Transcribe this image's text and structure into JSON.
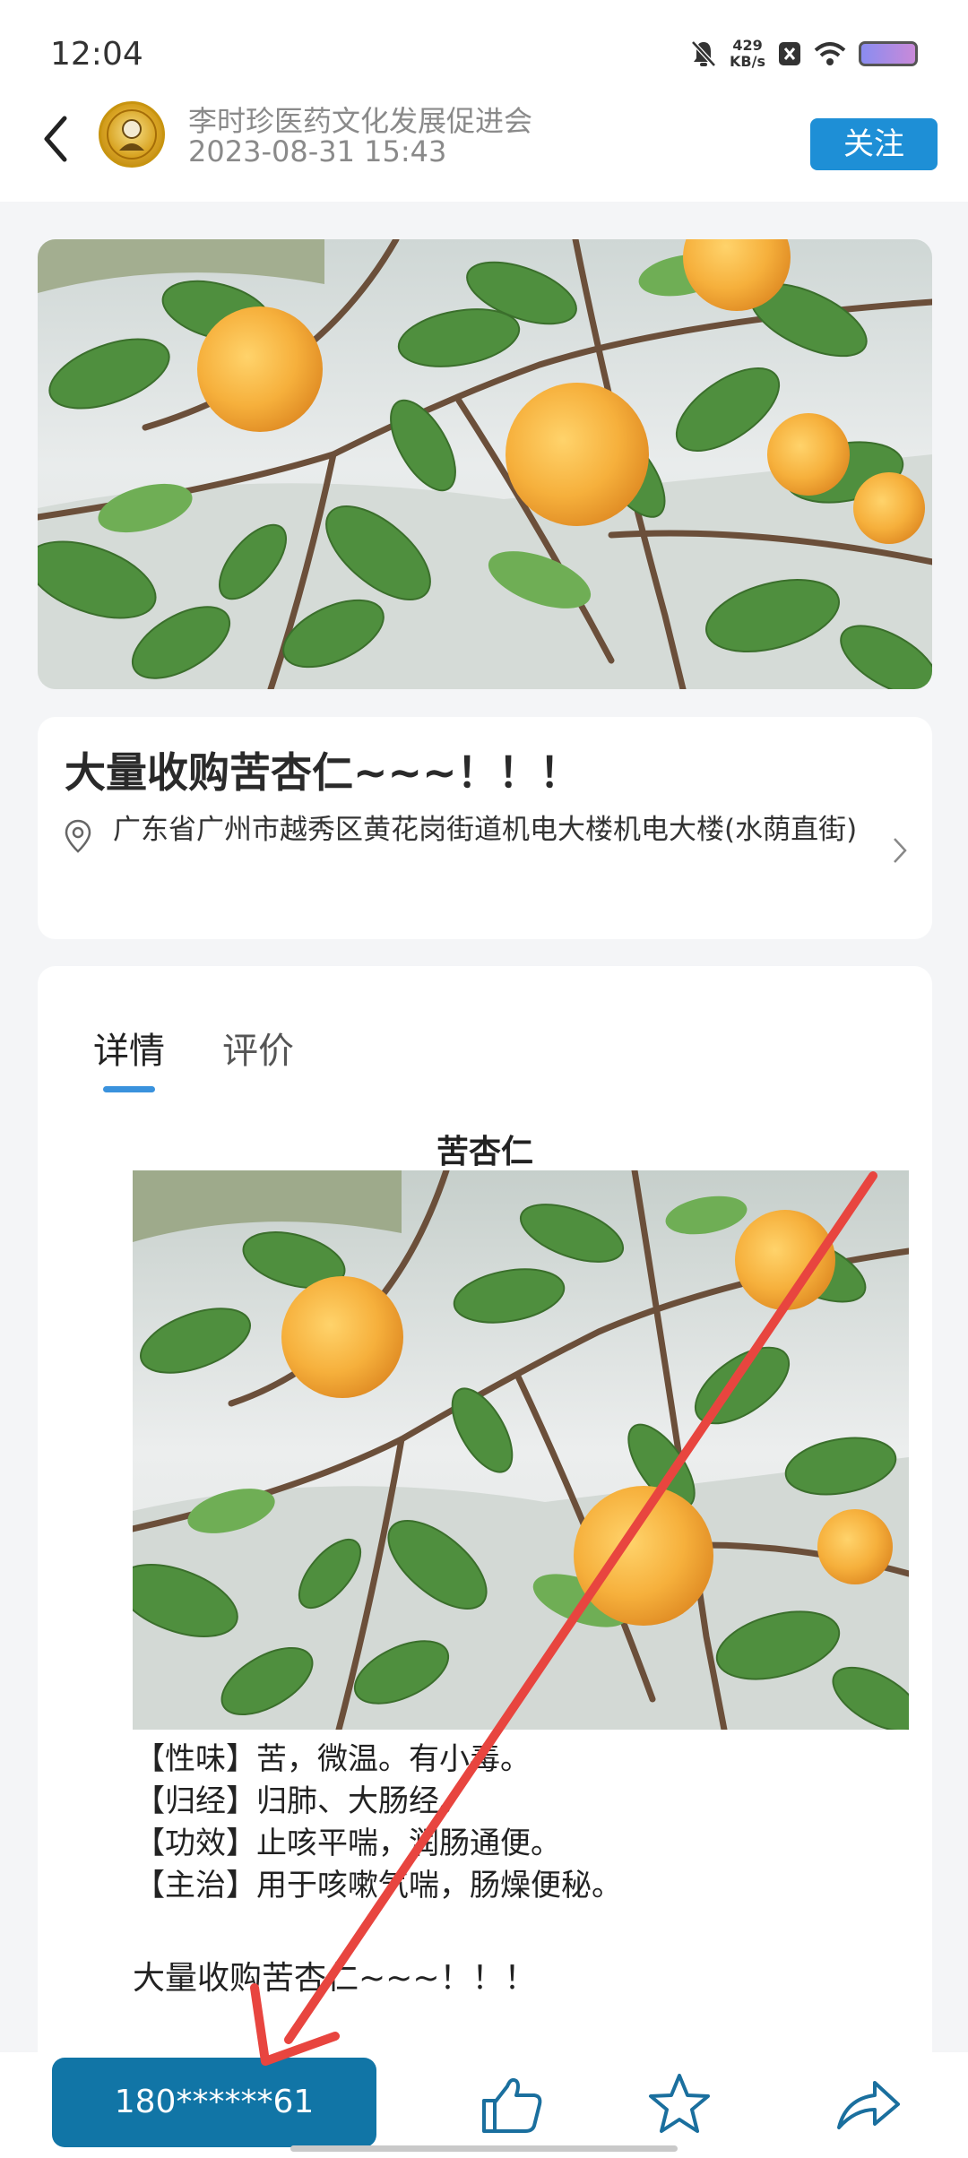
{
  "status_bar": {
    "time": "12:04",
    "speed_value": "429",
    "speed_unit": "KB/s"
  },
  "header": {
    "org_name": "李时珍医药文化发展促进会",
    "post_time": "2023-08-31 15:43",
    "follow_label": "关注"
  },
  "post": {
    "title": "大量收购苦杏仁~~~！！！",
    "address": "广东省广州市越秀区黄花岗街道机电大楼机电大楼(水荫直街)"
  },
  "tabs": [
    {
      "label": "详情",
      "active": true
    },
    {
      "label": "评价",
      "active": false
    }
  ],
  "detail": {
    "heading": "苦杏仁",
    "lines": [
      "【性味】苦，微温。有小毒。",
      "【归经】归肺、大肠经。",
      "【功效】止咳平喘，润肠通便。",
      "【主治】用于咳嗽气喘，肠燥便秘。"
    ],
    "footer_text": "大量收购苦杏仁~~~！！！"
  },
  "bottom_bar": {
    "phone": "180******61",
    "icons": [
      "thumbs-up-icon",
      "star-icon",
      "share-icon"
    ]
  },
  "colors": {
    "accent": "#1e8fd6",
    "phone_button": "#1175a6",
    "annotation_arrow": "#e8453f"
  }
}
